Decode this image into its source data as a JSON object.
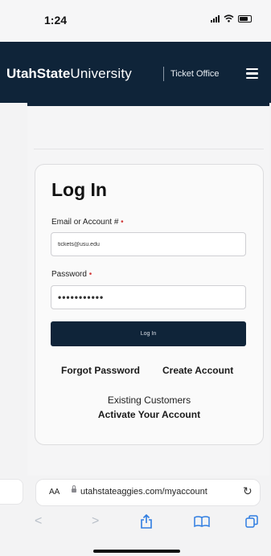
{
  "status_bar": {
    "time": "1:24"
  },
  "header": {
    "brand_bold": "UtahState",
    "brand_regular": "University",
    "section": "Ticket Office"
  },
  "login": {
    "title": "Log In",
    "email_label": "Email or Account #",
    "email_value": "tickets@usu.edu",
    "password_label": "Password",
    "password_value": "•••••••••••",
    "required_mark": "•",
    "submit_label": "Log In",
    "forgot_label": "Forgot Password",
    "create_label": "Create Account",
    "existing_text": "Existing Customers",
    "activate_label": "Activate Your Account"
  },
  "browser": {
    "text_size_label": "AA",
    "url": "utahstateaggies.com/myaccount",
    "reload_glyph": "↻",
    "back_glyph": "<",
    "forward_glyph": ">",
    "share_glyph": "⇪",
    "bookmarks_glyph": "📖",
    "tabs_glyph": "⧉"
  },
  "colors": {
    "brand_navy": "#0f2439",
    "required_red": "#d23a3a",
    "link_blue": "#2f7de1"
  }
}
